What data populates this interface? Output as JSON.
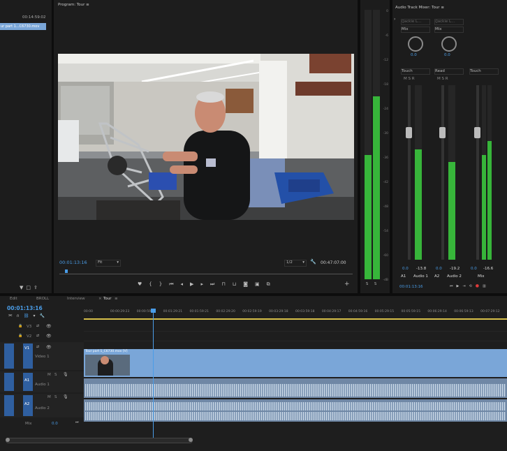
{
  "source": {
    "timecode": "00:14:59:02",
    "clip_name": "ur part 1...C6730.mov"
  },
  "program": {
    "title": "Program: Tour",
    "menu_icon": "menu-icon",
    "timecode": "00:01:13:16",
    "fit": "Fit",
    "resolution": "1/2",
    "duration": "00:47:07:00",
    "image_alt": "man explaining race car chassis in garage"
  },
  "meter_scale": [
    "0",
    "-6",
    "-12",
    "-18",
    "-24",
    "-30",
    "-36",
    "-42",
    "-48",
    "-54",
    "-60",
    "-dB"
  ],
  "meter_scale_right": [
    "-3",
    "-6",
    "-9",
    "-12",
    "-15",
    "-18",
    "-21",
    "-24",
    "-27",
    "-30",
    "-33",
    "-36",
    "-39",
    "-42",
    "-45",
    "-48",
    "-51",
    "-54",
    "-57",
    "-60"
  ],
  "mixer": {
    "title": "Audio Track Mixer: Tour",
    "channels": [
      {
        "input": "(Jackie L...",
        "mode": "Mix",
        "pan": "0.0",
        "automation": "Touch",
        "level": "-13.8",
        "id": "A1",
        "name": "Audio 1"
      },
      {
        "input": "(Jackie L...",
        "mode": "Mix",
        "pan": "0.0",
        "automation": "Read",
        "level": "-19.2",
        "id": "A2",
        "name": "Audio 2"
      },
      {
        "input": "",
        "mode": "",
        "pan": "",
        "automation": "Touch",
        "level": "-16.6",
        "id": "",
        "name": "Mix"
      }
    ],
    "master_level": "0.0",
    "footer_timecode": "00:01:13:16"
  },
  "sequence_tabs": [
    "Edit",
    "BROLL",
    "Interview",
    "Tour"
  ],
  "timeline": {
    "timecode": "00:01:13:16",
    "ruler": [
      "00:00",
      "00:00:29:23",
      "00:00:59:22",
      "00:01:29:21",
      "00:01:59:21",
      "00:02:29:20",
      "00:02:59:19",
      "00:03:29:18",
      "00:03:59:18",
      "00:04:29:17",
      "00:04:59:16",
      "00:05:29:15",
      "00:05:59:15",
      "00:06:29:14",
      "00:06:59:13",
      "00:07:29:12"
    ],
    "tracks": {
      "video": [
        {
          "id": "V3",
          "name": ""
        },
        {
          "id": "V2",
          "name": ""
        },
        {
          "id": "V1",
          "name": "Video 1"
        }
      ],
      "audio": [
        {
          "id": "A1",
          "name": "Audio 1"
        },
        {
          "id": "A2",
          "name": "Audio 2"
        }
      ],
      "mix": {
        "label": "Mix",
        "value": "0.0"
      }
    },
    "clip_label": "Tour part 1_C6730.mov [V]",
    "track_toggles": [
      "M",
      "S"
    ]
  },
  "colors": {
    "accent": "#4a9de8",
    "clip_video": "#7aa6d8",
    "clip_audio": "#6f87a5",
    "meter_green": "#37b53a",
    "playhead": "#4a9de8"
  }
}
